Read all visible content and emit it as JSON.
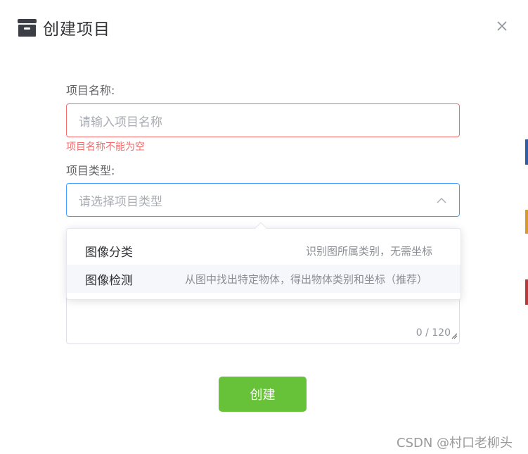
{
  "dialog": {
    "title": "创建项目",
    "title_icon": "archive-box-icon",
    "close_icon": "close-icon"
  },
  "form": {
    "name_label": "项目名称:",
    "name_placeholder": "请输入项目名称",
    "name_error": "项目名称不能为空",
    "type_label": "项目类型:",
    "type_placeholder": "请选择项目类型",
    "type_arrow_icon": "chevron-up-icon",
    "description_value": "",
    "description_count": "0 / 120",
    "submit_label": "创建"
  },
  "dropdown": {
    "options": [
      {
        "label": "图像分类",
        "description": "识别图所属类别，无需坐标",
        "hovered": false
      },
      {
        "label": "图像检测",
        "description": "从图中找出特定物体，得出物体类别和坐标（推荐）",
        "hovered": true
      }
    ]
  },
  "colors": {
    "error": "#f56c6c",
    "focus_border": "#409eff",
    "submit_button": "#67c23a",
    "option_hover": "#f5f7fa"
  },
  "watermark": "CSDN @村口老柳头"
}
